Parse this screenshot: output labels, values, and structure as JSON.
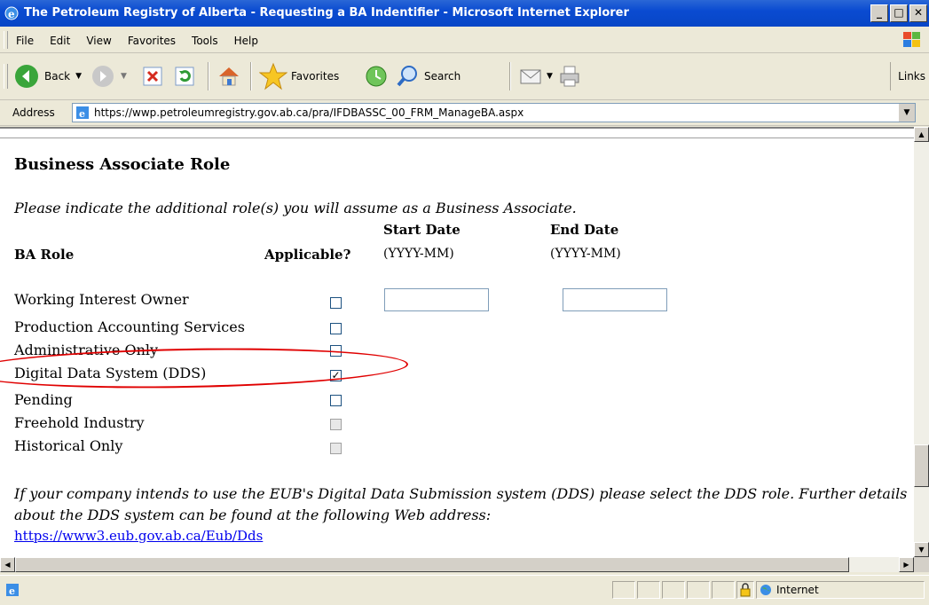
{
  "window": {
    "title": "The Petroleum Registry of Alberta - Requesting a BA Indentifier - Microsoft Internet Explorer"
  },
  "menu": [
    "File",
    "Edit",
    "View",
    "Favorites",
    "Tools",
    "Help"
  ],
  "toolbar": {
    "back": "Back",
    "favorites": "Favorites",
    "search": "Search",
    "links": "Links"
  },
  "address": {
    "label": "Address",
    "url": "https://wwp.petroleumregistry.gov.ab.ca/pra/IFDBASSC_00_FRM_ManageBA.aspx"
  },
  "page": {
    "heading": "Business Associate Role",
    "intro": "Please indicate the additional role(s) you will assume as a Business Associate.",
    "columns": {
      "role": "BA Role",
      "applicable": "Applicable?",
      "start": "Start Date",
      "start_fmt": "(YYYY-MM)",
      "end": "End Date",
      "end_fmt": "(YYYY-MM)"
    },
    "roles": [
      {
        "label": "Working Interest Owner",
        "checked": false,
        "disabled": false
      },
      {
        "label": "Production Accounting Services",
        "checked": false,
        "disabled": false
      },
      {
        "label": "Administrative Only",
        "checked": false,
        "disabled": false
      },
      {
        "label": "Digital Data System (DDS)",
        "checked": true,
        "disabled": false
      },
      {
        "label": "Pending",
        "checked": false,
        "disabled": false
      },
      {
        "label": "Freehold Industry",
        "checked": false,
        "disabled": true
      },
      {
        "label": "Historical Only",
        "checked": false,
        "disabled": true
      }
    ],
    "note": "If your company intends to use the EUB's Digital Data Submission system (DDS) please select the DDS role. Further details about the DDS system can be found at the following Web address:",
    "link": "https://www3.eub.gov.ab.ca/Eub/Dds"
  },
  "status": {
    "zone": "Internet"
  }
}
